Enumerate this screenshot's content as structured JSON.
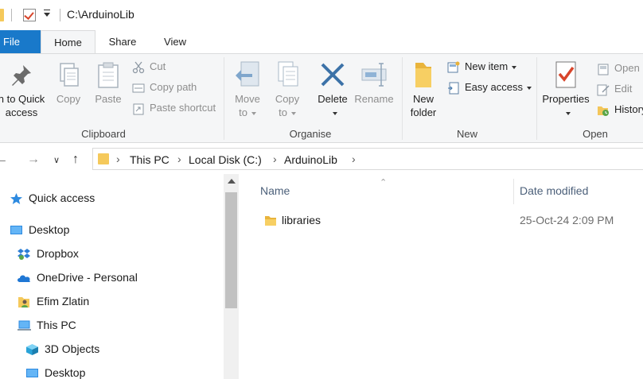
{
  "titlebar": {
    "path": "C:\\ArduinoLib"
  },
  "tabs": {
    "file": "File",
    "home": "Home",
    "share": "Share",
    "view": "View"
  },
  "ribbon": {
    "clipboard": {
      "label": "Clipboard",
      "pin_line1": "n to Quick",
      "pin_line2": "access",
      "copy": "Copy",
      "paste": "Paste",
      "cut": "Cut",
      "copy_path": "Copy path",
      "paste_shortcut": "Paste shortcut"
    },
    "organise": {
      "label": "Organise",
      "move_line1": "Move",
      "move_line2": "to",
      "copy_line1": "Copy",
      "copy_line2": "to",
      "delete": "Delete",
      "rename": "Rename"
    },
    "new": {
      "label": "New",
      "new_folder_line1": "New",
      "new_folder_line2": "folder",
      "new_item": "New item",
      "easy_access": "Easy access"
    },
    "open": {
      "label": "Open",
      "properties": "Properties",
      "open": "Open",
      "edit": "Edit",
      "history": "History"
    }
  },
  "address": {
    "crumbs": [
      "This PC",
      "Local Disk (C:)",
      "ArduinoLib"
    ],
    "back_icon": "back-arrow-icon",
    "forward_icon": "forward-arrow-icon",
    "up_icon": "up-arrow-icon"
  },
  "navpane": {
    "items": [
      {
        "label": "Quick access",
        "icon": "star-icon"
      },
      {
        "label": "Desktop",
        "icon": "desktop-icon"
      },
      {
        "label": "Dropbox",
        "icon": "dropbox-icon"
      },
      {
        "label": "OneDrive - Personal",
        "icon": "cloud-icon"
      },
      {
        "label": "Efim Zlatin",
        "icon": "user-folder-icon"
      },
      {
        "label": "This PC",
        "icon": "computer-icon"
      },
      {
        "label": "3D Objects",
        "icon": "cube-icon"
      },
      {
        "label": "Desktop",
        "icon": "desktop-icon"
      }
    ]
  },
  "content": {
    "columns": {
      "name": "Name",
      "date": "Date modified"
    },
    "files": [
      {
        "name": "libraries",
        "date": "25-Oct-24 2:09 PM",
        "type": "folder"
      }
    ]
  },
  "colors": {
    "accent": "#1979ca",
    "folder": "#f5c95b",
    "ribbon_bg": "#f5f6f7"
  }
}
